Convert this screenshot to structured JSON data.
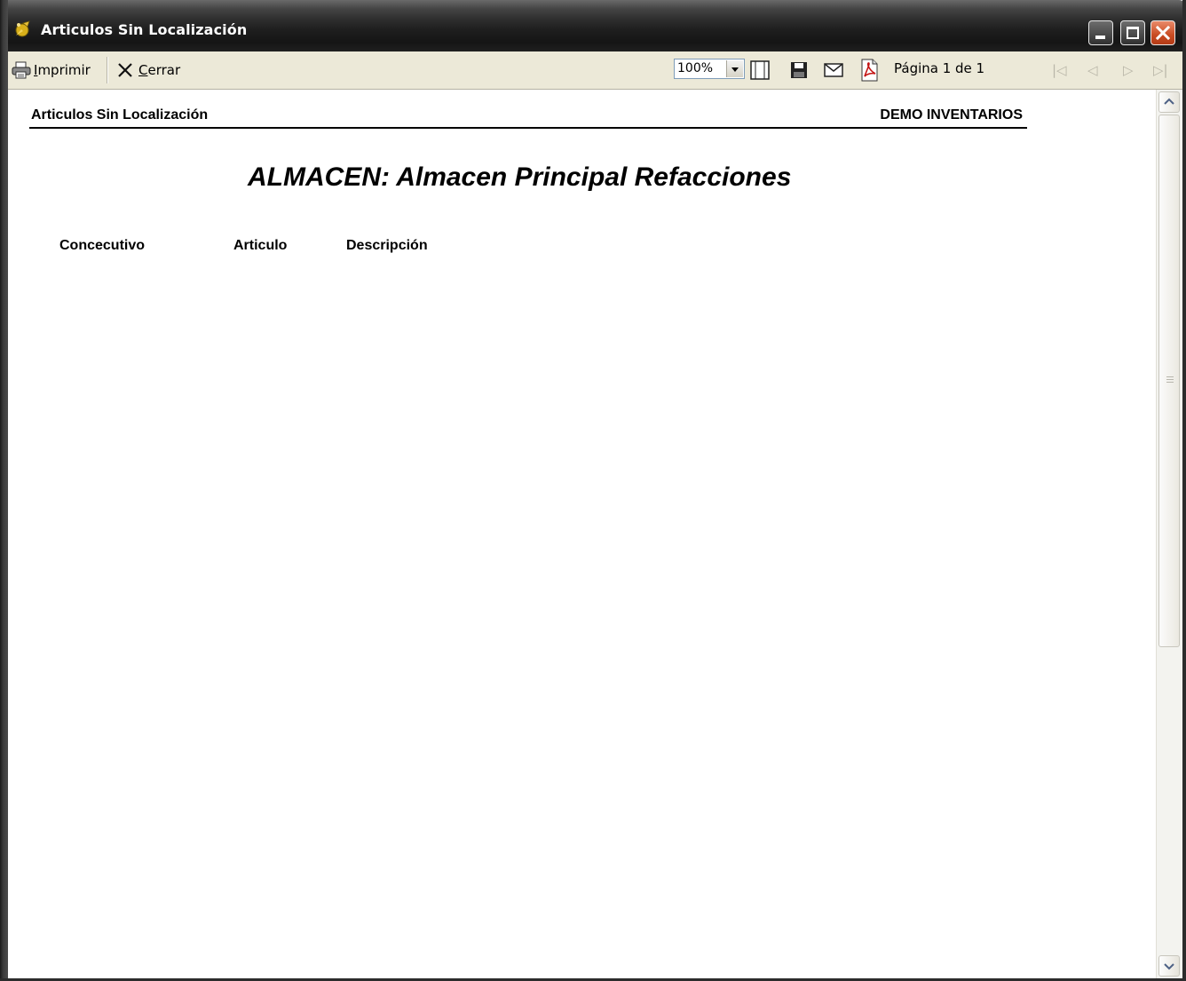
{
  "window": {
    "title": "Articulos Sin Localización"
  },
  "toolbar": {
    "print_label": "Imprimir",
    "print_accel": "I",
    "print_rest": "mprimir",
    "close_label": "Cerrar",
    "close_accel": "C",
    "close_rest": "errar",
    "zoom_value": "100%",
    "page_status": "Página 1 de 1"
  },
  "report": {
    "title": "Articulos Sin Localización",
    "company": "DEMO INVENTARIOS",
    "heading": "ALMACEN: Almacen Principal Refacciones",
    "columns": [
      "Concecutivo",
      "Articulo",
      "Descripción"
    ]
  },
  "colors": {
    "toolbar_bg": "#ece9d8",
    "title_bar": "#1e1e1e",
    "close_button": "#c94b22"
  }
}
